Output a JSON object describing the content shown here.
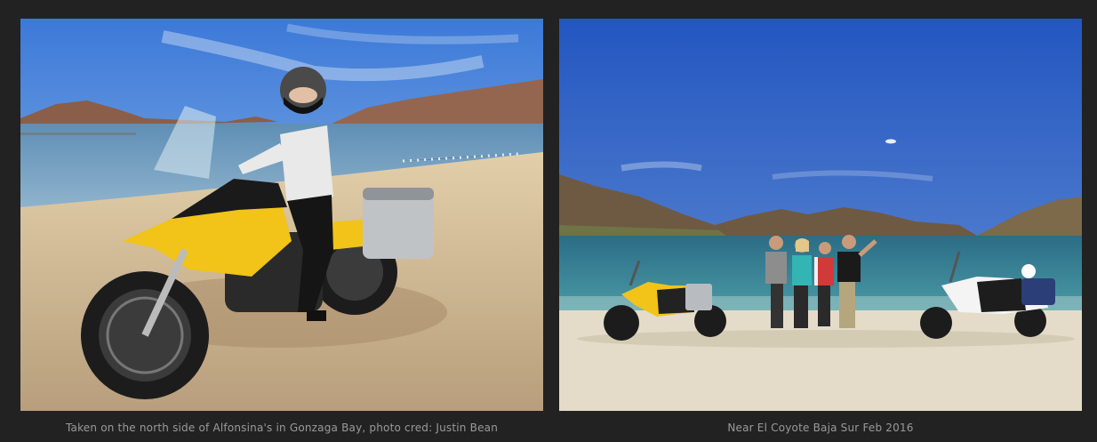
{
  "gallery": {
    "items": [
      {
        "caption": "Taken on the north side of Alfonsina's in Gonzaga Bay, photo cred: Justin Bean",
        "photo": "rider-on-yellow-motorcycle-beach"
      },
      {
        "caption": "Near El Coyote Baja Sur Feb 2016",
        "photo": "group-with-two-motorcycles-beach"
      }
    ]
  },
  "colors": {
    "background": "#222222",
    "caption": "#9a9a9a",
    "sky": "#2f5fc4",
    "water": "#2b6d86",
    "sand": "#d9c7a6",
    "moto_yellow": "#f2c318"
  }
}
